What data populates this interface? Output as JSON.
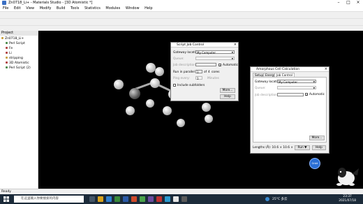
{
  "window": {
    "title": "Zn0718_Li+ - Materials Studio - [3D Atomistic *]"
  },
  "menu": [
    "File",
    "Edit",
    "View",
    "Modify",
    "Build",
    "Tools",
    "Statistics",
    "Modules",
    "Window",
    "Help"
  ],
  "project": {
    "header": "Project",
    "items": [
      {
        "label": "Zn0718_Li+",
        "level": 0
      },
      {
        "label": "Perl Script",
        "level": 1
      },
      {
        "label": "Fe",
        "level": 1
      },
      {
        "label": "Li",
        "level": 1
      },
      {
        "label": "stripping",
        "level": 1
      },
      {
        "label": "3D Atomistic",
        "level": 1
      },
      {
        "label": "Perl Script (2)",
        "level": 1
      }
    ]
  },
  "script_dialog": {
    "title": "Script Job Control",
    "gateway_label": "Gateway location:",
    "gateway_value": "My Computer",
    "queue_label": "Queue:",
    "job_desc_label": "Job description:",
    "automatic_label": "Automatic",
    "run_parallel_label": "Run in parallel on",
    "run_parallel_value": "1",
    "of_label": "of",
    "cores_value": "4",
    "cores_label": "cores",
    "ping_label": "Ping every:",
    "ping_value": "1",
    "minutes_label": "Minutes",
    "subfolders_label": "Include subfolders",
    "more_button": "More...",
    "help_button": "Help"
  },
  "dmol_dialog": {
    "title": "Amorphous Cell Calculation",
    "tabs": [
      "Setup",
      "Energy",
      "Job Control"
    ],
    "active_tab": "Job Control",
    "gateway_label": "Gateway location:",
    "gateway_value": "My Computer",
    "queue_label": "Queue:",
    "job_desc_label": "Job description:",
    "automatic_label": "Automatic",
    "more_button": "More...",
    "lattice_text": "Lengths (Å):  10.6 × 10.6 × 10.6",
    "run_button": "Run",
    "help_button": "Help"
  },
  "status": {
    "text": "Ready"
  },
  "taskbar": {
    "search_placeholder": "在这里输入你要搜索的内容",
    "weather": "25°C 多云",
    "time": "23:37",
    "date": "2021/07/18"
  },
  "cursor_label": "Orbit",
  "colors": {
    "accent": "#2b6fd6",
    "taskbar": "#1c2b3a"
  }
}
